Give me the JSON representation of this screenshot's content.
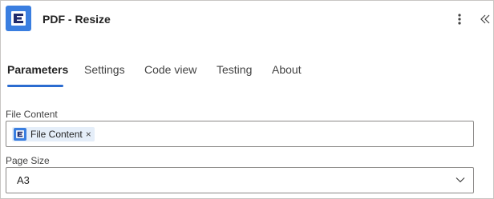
{
  "header": {
    "title": "PDF - Resize",
    "icon": "pdf-app-icon",
    "more_icon": "more-vertical-icon",
    "collapse_icon": "double-chevron-left-icon"
  },
  "tabs": [
    {
      "label": "Parameters",
      "active": true
    },
    {
      "label": "Settings",
      "active": false
    },
    {
      "label": "Code view",
      "active": false
    },
    {
      "label": "Testing",
      "active": false
    },
    {
      "label": "About",
      "active": false
    }
  ],
  "fields": {
    "file_content": {
      "label": "File Content",
      "token": {
        "label": "File Content",
        "remove": "×",
        "icon": "pdf-app-icon"
      }
    },
    "page_size": {
      "label": "Page Size",
      "value": "A3"
    }
  },
  "colors": {
    "accent": "#2b6cd0",
    "app_icon_bg": "#3a7ee0",
    "token_bg": "#e5eef9",
    "border": "#8a8886"
  }
}
